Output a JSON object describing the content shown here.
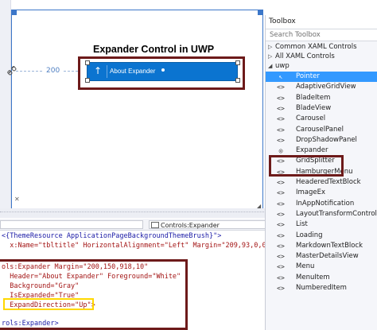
{
  "designer": {
    "page_title": "Expander Control in UWP",
    "margin_value": "200",
    "expander_header": "About Expander"
  },
  "editor": {
    "nav_breadcrumb": "Controls:Expander",
    "lines": [
      "<{ThemeResource ApplicationPageBackgroundThemeBrush}\">",
      "  x:Name=\"tbltitle\" HorizontalAlignment=\"Left\" Margin=\"209,93,0,0\"",
      "",
      "ols:Expander Margin=\"200,150,918,10\"",
      "  Header=\"About Expander\" Foreground=\"White\"",
      "  Background=\"Gray\"",
      "  IsExpanded=\"True\"",
      "  ExpandDirection=\"Up\">",
      "",
      "rols:Expander>"
    ]
  },
  "toolbox": {
    "title": "Toolbox",
    "search_placeholder": "Search Toolbox",
    "groups": [
      {
        "label": "Common XAML Controls",
        "expanded": false
      },
      {
        "label": "All XAML Controls",
        "expanded": false
      },
      {
        "label": "uwp",
        "expanded": true
      }
    ],
    "items": [
      {
        "label": "Pointer",
        "icon": "pointer-icon",
        "glyph": "↖",
        "selected": true
      },
      {
        "label": "AdaptiveGridView",
        "icon": "control-icon",
        "glyph": "<>",
        "selected": false
      },
      {
        "label": "BladeItem",
        "icon": "control-icon",
        "glyph": "<>",
        "selected": false
      },
      {
        "label": "BladeView",
        "icon": "control-icon",
        "glyph": "<>",
        "selected": false
      },
      {
        "label": "Carousel",
        "icon": "control-icon",
        "glyph": "<>",
        "selected": false
      },
      {
        "label": "CarouselPanel",
        "icon": "control-icon",
        "glyph": "<>",
        "selected": false
      },
      {
        "label": "DropShadowPanel",
        "icon": "control-icon",
        "glyph": "<>",
        "selected": false
      },
      {
        "label": "Expander",
        "icon": "expander-icon",
        "glyph": "◎",
        "selected": false
      },
      {
        "label": "GridSplitter",
        "icon": "control-icon",
        "glyph": "<>",
        "selected": false
      },
      {
        "label": "HamburgerMenu",
        "icon": "control-icon",
        "glyph": "<>",
        "selected": false
      },
      {
        "label": "HeaderedTextBlock",
        "icon": "control-icon",
        "glyph": "<>",
        "selected": false
      },
      {
        "label": "ImageEx",
        "icon": "control-icon",
        "glyph": "<>",
        "selected": false
      },
      {
        "label": "InAppNotification",
        "icon": "control-icon",
        "glyph": "<>",
        "selected": false
      },
      {
        "label": "LayoutTransformControl",
        "icon": "control-icon",
        "glyph": "<>",
        "selected": false
      },
      {
        "label": "List",
        "icon": "control-icon",
        "glyph": "<>",
        "selected": false
      },
      {
        "label": "Loading",
        "icon": "control-icon",
        "glyph": "<>",
        "selected": false
      },
      {
        "label": "MarkdownTextBlock",
        "icon": "control-icon",
        "glyph": "<>",
        "selected": false
      },
      {
        "label": "MasterDetailsView",
        "icon": "control-icon",
        "glyph": "<>",
        "selected": false
      },
      {
        "label": "Menu",
        "icon": "control-icon",
        "glyph": "<>",
        "selected": false
      },
      {
        "label": "MenuItem",
        "icon": "control-icon",
        "glyph": "<>",
        "selected": false
      },
      {
        "label": "NumberedItem",
        "icon": "control-icon",
        "glyph": "<>",
        "selected": false
      }
    ]
  },
  "colors": {
    "expander_fill": "#0b74d0",
    "highlight_dark_red": "#6d1a1a",
    "highlight_yellow": "#ffd800",
    "selection_blue": "#3399ff"
  }
}
